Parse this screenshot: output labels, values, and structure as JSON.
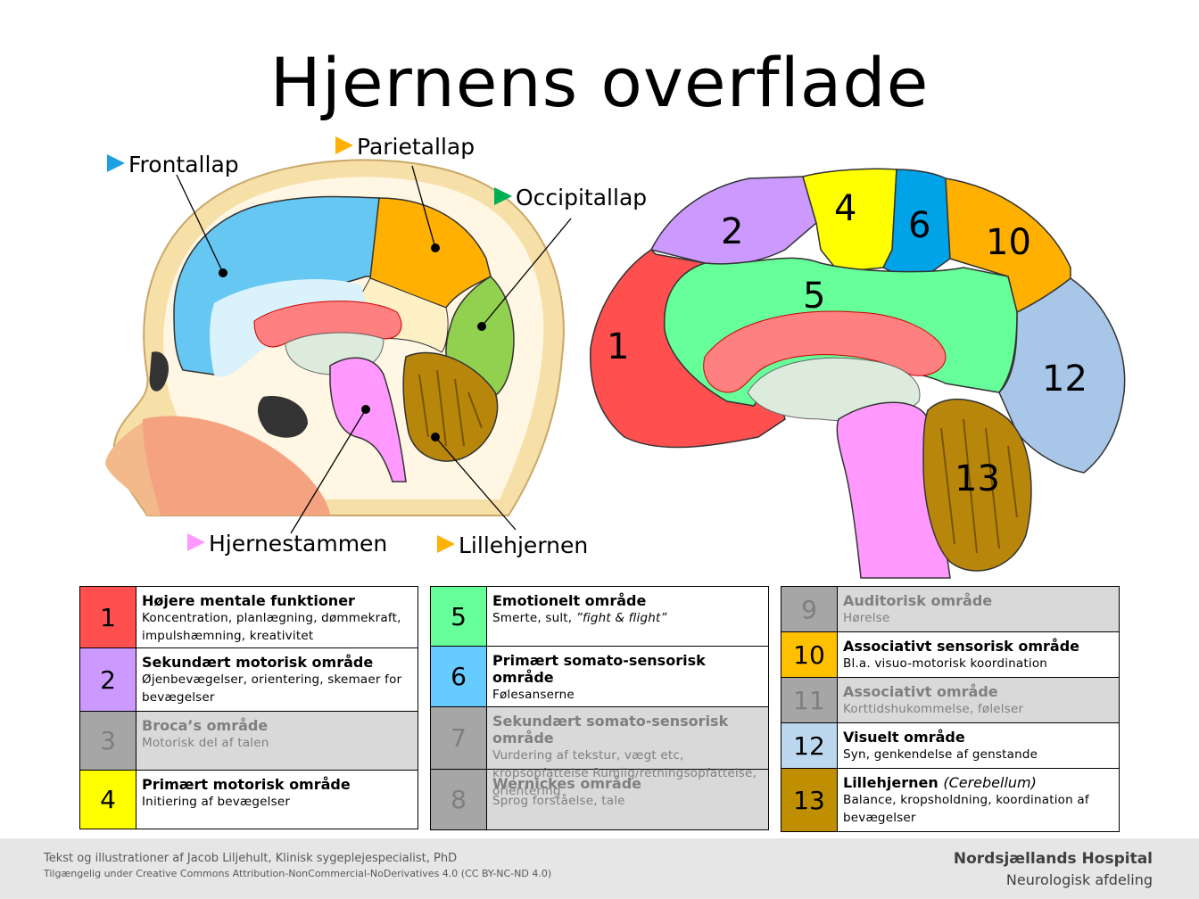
{
  "title": "Hjernens overflade",
  "labels": {
    "frontallap": {
      "text": "Frontallap",
      "color": "#1ba1e2"
    },
    "parietallap": {
      "text": "Parietallap",
      "color": "#ffb000"
    },
    "occipitallap": {
      "text": "Occipitallap",
      "color": "#00b050"
    },
    "hjernestammen": {
      "text": "Hjernestammen",
      "color": "#ff99ff"
    },
    "lillehjernen": {
      "text": "Lillehjernen",
      "color": "#ffb000"
    }
  },
  "brain_numbers": [
    "1",
    "2",
    "4",
    "6",
    "10",
    "5",
    "12",
    "13"
  ],
  "tables": [
    [
      {
        "n": "1",
        "color": "#ff4f4f",
        "title": "Højere mentale funktioner",
        "desc": "Koncentration, planlægning, dømmekraft, impulshæmning, kreativitet",
        "dim": false,
        "h": 70
      },
      {
        "n": "2",
        "color": "#cc99ff",
        "title": "Sekundært motorisk område",
        "desc": "Øjenbevægelser, orientering, skemaer for bevægelser",
        "dim": false,
        "h": 71
      },
      {
        "n": "3",
        "color": "",
        "title": "Broca’s område",
        "desc": "Motorisk del af talen",
        "dim": true,
        "h": 66
      },
      {
        "n": "4",
        "color": "#ffff00",
        "title": "Primært motorisk område",
        "desc": "Initiering af bevægelser",
        "dim": false,
        "h": 66
      }
    ],
    [
      {
        "n": "5",
        "color": "#66ff99",
        "title": "Emotionelt område",
        "desc": "Smerte, sult, ",
        "desc_italic": "”fight & flight”",
        "dim": false,
        "h": 68
      },
      {
        "n": "6",
        "color": "#66ccff",
        "title": "Primært somato-sensorisk område",
        "desc": "Følesanserne",
        "dim": false,
        "h": 68
      },
      {
        "n": "7",
        "color": "",
        "title": "Sekundært somato-sensorisk område",
        "desc": "Vurdering af tekstur, vægt etc, kropsopfattelse Rumlig/retningsopfattelse, orientering",
        "dim": true,
        "h": 70
      },
      {
        "n": "8",
        "color": "",
        "title": "Wernickes område",
        "desc": "Sprog forståelse, tale",
        "dim": true,
        "h": 68
      }
    ],
    [
      {
        "n": "9",
        "color": "",
        "title": "Auditorisk område",
        "desc": "Hørelse",
        "dim": true,
        "h": 52
      },
      {
        "n": "10",
        "color": "#ffc000",
        "title": "Associativt sensorisk område",
        "desc": "Bl.a. visuo-motorisk koordination",
        "dim": false,
        "h": 51
      },
      {
        "n": "11",
        "color": "",
        "title": "Associativt område",
        "desc": "Korttidshukommelse,  følelser",
        "dim": true,
        "h": 51
      },
      {
        "n": "12",
        "color": "#bdd7ee",
        "title": "Visuelt område",
        "desc": "Syn, genkendelse af genstande",
        "dim": false,
        "h": 51
      },
      {
        "n": "13",
        "color": "#bf8f00",
        "title": "Lillehjernen",
        "title_italic": "(Cerebellum)",
        "desc": "Balance, kropsholdning, koordination af bevægelser",
        "dim": false,
        "h": 71
      }
    ]
  ],
  "footer": {
    "credit": "Tekst og illustrationer af Jacob Liljehult, Klinisk sygeplejespecialist, PhD",
    "license": "Tilgængelig under Creative Commons Attribution-NonCommercial-NoDerivatives 4.0 (CC BY-NC-ND  4.0)",
    "hospital": "Nordsjællands Hospital",
    "department": "Neurologisk afdeling"
  }
}
